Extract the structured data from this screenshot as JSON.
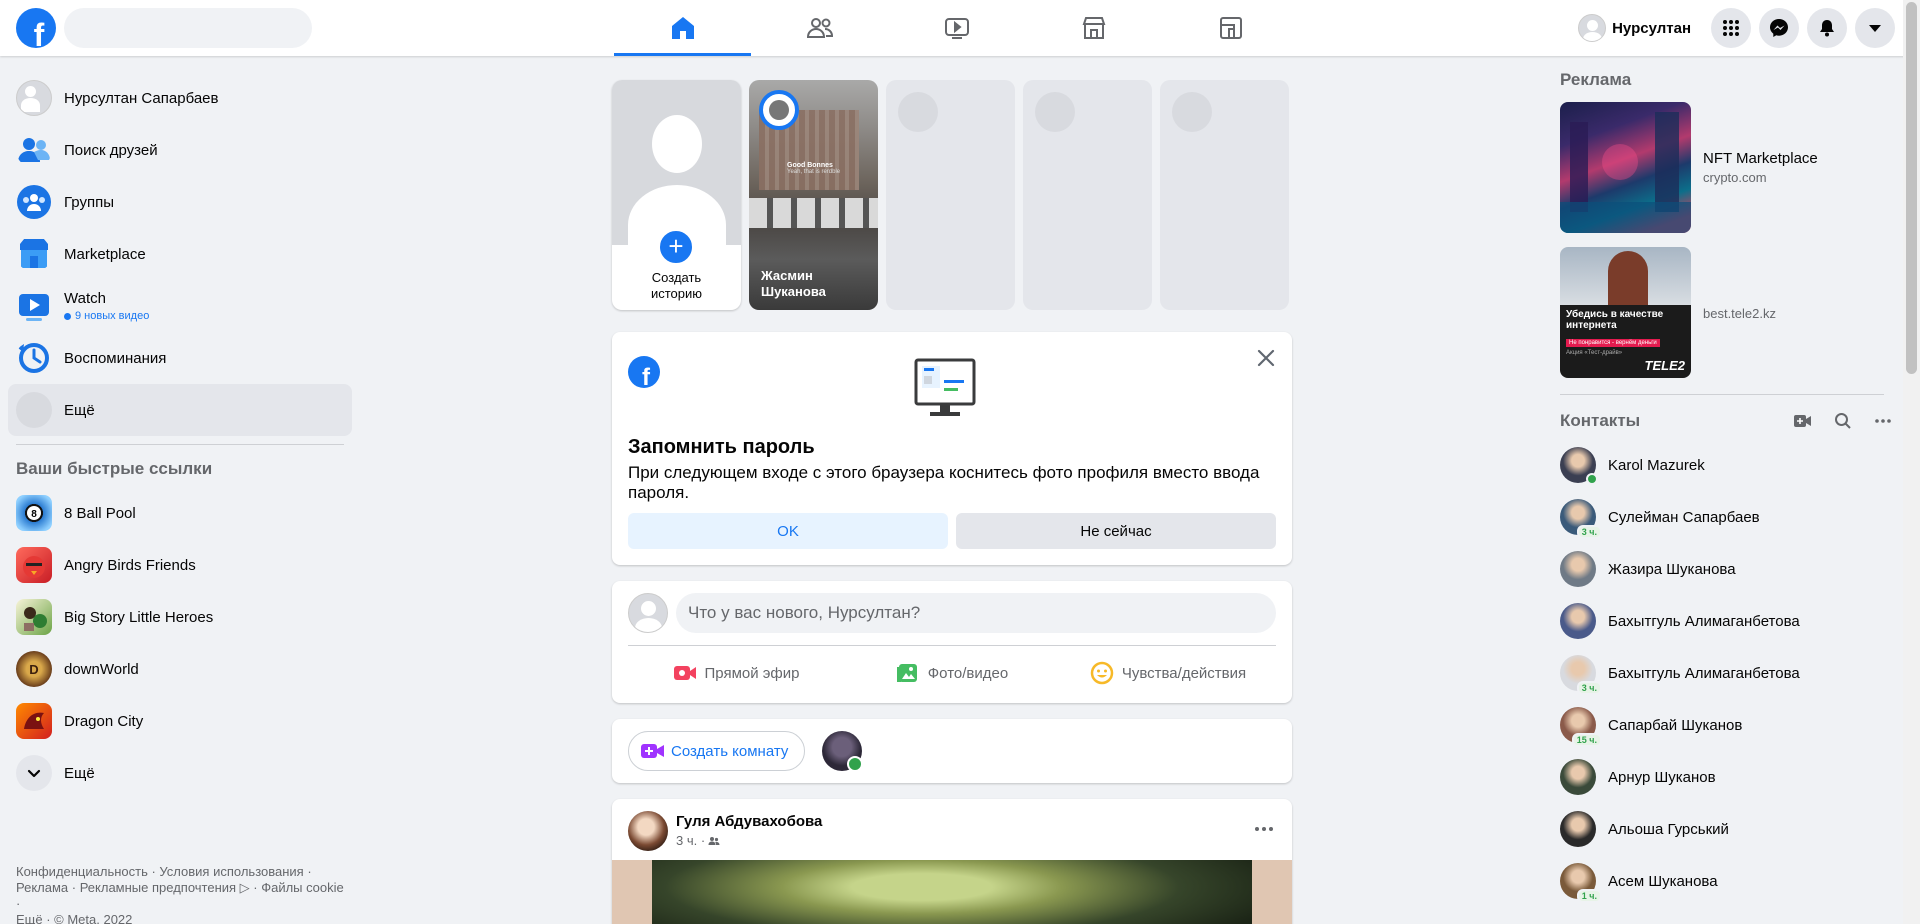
{
  "topbar": {
    "profile_name": "Нурсултан",
    "nav_tabs": [
      "home",
      "friends",
      "watch",
      "marketplace",
      "gaming"
    ]
  },
  "left_sidebar": {
    "items": [
      {
        "label": "Нурсултан Сапарбаев",
        "icon": "profile-avatar"
      },
      {
        "label": "Поиск друзей",
        "icon": "friends-icon"
      },
      {
        "label": "Группы",
        "icon": "groups-icon"
      },
      {
        "label": "Marketplace",
        "icon": "marketplace-icon"
      },
      {
        "label": "Watch",
        "icon": "watch-icon",
        "sub": "9 новых видео"
      },
      {
        "label": "Воспоминания",
        "icon": "memories-icon"
      },
      {
        "label": "Ещё",
        "icon": "more-icon"
      }
    ],
    "shortcuts_title": "Ваши быстрые ссылки",
    "shortcuts": [
      {
        "label": "8 Ball Pool"
      },
      {
        "label": "Angry Birds Friends"
      },
      {
        "label": "Big Story Little Heroes"
      },
      {
        "label": "downWorld"
      },
      {
        "label": "Dragon City"
      }
    ],
    "shortcuts_more": "Ещё",
    "footer": {
      "line1": "Конфиденциальность · Условия использования ·",
      "line2": "Реклама · Рекламные предпочтения ▷ · Файлы cookie ·",
      "line3": "Ещё · © Meta, 2022"
    }
  },
  "stories": {
    "create_label_1": "Создать",
    "create_label_2": "историю",
    "story_name_1": "Жасмин",
    "story_name_2": "Шуканова",
    "story_overlay_1": "Good Bonnes",
    "story_overlay_2": "Yeah, that is rerdble"
  },
  "remember_card": {
    "title": "Запомнить пароль",
    "text": "При следующем входе с этого браузера коснитесь фото профиля вместо ввода пароля.",
    "ok_label": "OK",
    "later_label": "Не сейчас"
  },
  "composer": {
    "placeholder": "Что у вас нового, Нурсултан?",
    "actions": [
      {
        "label": "Прямой эфир",
        "icon": "live-video-icon",
        "color": "#f3425f"
      },
      {
        "label": "Фото/видео",
        "icon": "photo-icon",
        "color": "#45bd62"
      },
      {
        "label": "Чувства/действия",
        "icon": "feeling-icon",
        "color": "#f7b928"
      }
    ]
  },
  "rooms": {
    "create_label": "Создать комнату"
  },
  "post": {
    "author": "Гуля Абдувахобова",
    "time": "3 ч. ·"
  },
  "right_sidebar": {
    "ads_title": "Реклама",
    "ads": [
      {
        "title": "NFT Marketplace",
        "source": "crypto.com"
      },
      {
        "title": "",
        "source": "best.tele2.kz",
        "banner_text": "Убедись в качестве интернета",
        "banner_tag": "Не понравится - вернём деньги",
        "banner_note": "Акция «Тест-драйв»",
        "brand": "TELE2"
      }
    ],
    "contacts_title": "Контакты",
    "contacts": [
      {
        "name": "Karol Mazurek",
        "status": "online",
        "ago": "",
        "color": "#3b3f52"
      },
      {
        "name": "Сулейман Сапарбаев",
        "status": "ago",
        "ago": "3 ч.",
        "color": "#3a5a7a"
      },
      {
        "name": "Жазира Шуканова",
        "status": "none",
        "ago": "",
        "color": "#6f7a86"
      },
      {
        "name": "Бахытгуль Алимаганбетова",
        "status": "none",
        "ago": "",
        "color": "#4a5a8a"
      },
      {
        "name": "Бахытгуль Алимаганбетова",
        "status": "ago",
        "ago": "3 ч.",
        "color": "#d8dadf"
      },
      {
        "name": "Сапарбай Шуканов",
        "status": "ago",
        "ago": "15 ч.",
        "color": "#8a5a4a"
      },
      {
        "name": "Арнур Шуканов",
        "status": "none",
        "ago": "",
        "color": "#3a4a3a"
      },
      {
        "name": "Альоша Гурський",
        "status": "none",
        "ago": "",
        "color": "#2a2a2a"
      },
      {
        "name": "Асем Шуканова",
        "status": "ago",
        "ago": "1 ч.",
        "color": "#7a5a3a"
      }
    ]
  },
  "colors": {
    "brand": "#1877f2",
    "online": "#31a24c"
  }
}
